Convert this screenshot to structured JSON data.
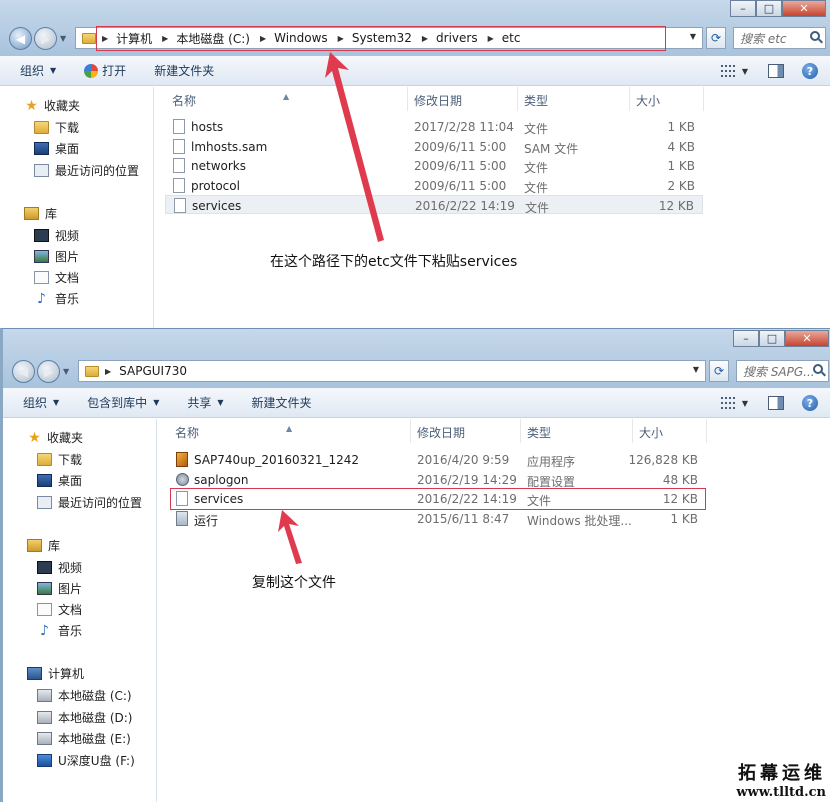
{
  "window_top": {
    "breadcrumbs": [
      "计算机",
      "本地磁盘 (C:)",
      "Windows",
      "System32",
      "drivers",
      "etc"
    ],
    "search_placeholder": "搜索 etc",
    "toolbar": {
      "organize": "组织",
      "open": "打开",
      "new_folder": "新建文件夹"
    },
    "sidebar": {
      "favorites": "收藏夹",
      "downloads": "下载",
      "desktop": "桌面",
      "recent": "最近访问的位置",
      "libraries": "库",
      "videos": "视频",
      "pictures": "图片",
      "documents": "文档",
      "music": "音乐"
    },
    "columns": {
      "name": "名称",
      "modified": "修改日期",
      "type": "类型",
      "size": "大小"
    },
    "files": [
      {
        "name": "hosts",
        "modified": "2017/2/28 11:04",
        "type": "文件",
        "size": "1 KB"
      },
      {
        "name": "lmhosts.sam",
        "modified": "2009/6/11 5:00",
        "type": "SAM 文件",
        "size": "4 KB"
      },
      {
        "name": "networks",
        "modified": "2009/6/11 5:00",
        "type": "文件",
        "size": "1 KB"
      },
      {
        "name": "protocol",
        "modified": "2009/6/11 5:00",
        "type": "文件",
        "size": "2 KB"
      },
      {
        "name": "services",
        "modified": "2016/2/22 14:19",
        "type": "文件",
        "size": "12 KB"
      }
    ]
  },
  "window_bottom": {
    "breadcrumbs": [
      "SAPGUI730"
    ],
    "search_placeholder": "搜索 SAPG...",
    "toolbar": {
      "organize": "组织",
      "include_library": "包含到库中",
      "share": "共享",
      "new_folder": "新建文件夹"
    },
    "sidebar": {
      "favorites": "收藏夹",
      "downloads": "下载",
      "desktop": "桌面",
      "recent": "最近访问的位置",
      "libraries": "库",
      "videos": "视频",
      "pictures": "图片",
      "documents": "文档",
      "music": "音乐",
      "computer": "计算机",
      "drive_c": "本地磁盘 (C:)",
      "drive_d": "本地磁盘 (D:)",
      "drive_e": "本地磁盘 (E:)",
      "drive_f": "U深度U盘 (F:)"
    },
    "columns": {
      "name": "名称",
      "modified": "修改日期",
      "type": "类型",
      "size": "大小"
    },
    "files": [
      {
        "name": "SAP740up_20160321_1242",
        "modified": "2016/4/20 9:59",
        "type": "应用程序",
        "size": "126,828 KB"
      },
      {
        "name": "saplogon",
        "modified": "2016/2/19 14:29",
        "type": "配置设置",
        "size": "48 KB"
      },
      {
        "name": "services",
        "modified": "2016/2/22 14:19",
        "type": "文件",
        "size": "12 KB"
      },
      {
        "name": "运行",
        "modified": "2015/6/11 8:47",
        "type": "Windows 批处理...",
        "size": "1 KB"
      }
    ]
  },
  "annotations": {
    "paste_note": "在这个路径下的etc文件下粘贴services",
    "copy_note": "复制这个文件"
  },
  "watermark": {
    "line1": "拓幕运维",
    "line2": "www.tlltd.cn"
  },
  "colors": {
    "highlight": "#d6394d",
    "arrow": "#e03a4e"
  }
}
